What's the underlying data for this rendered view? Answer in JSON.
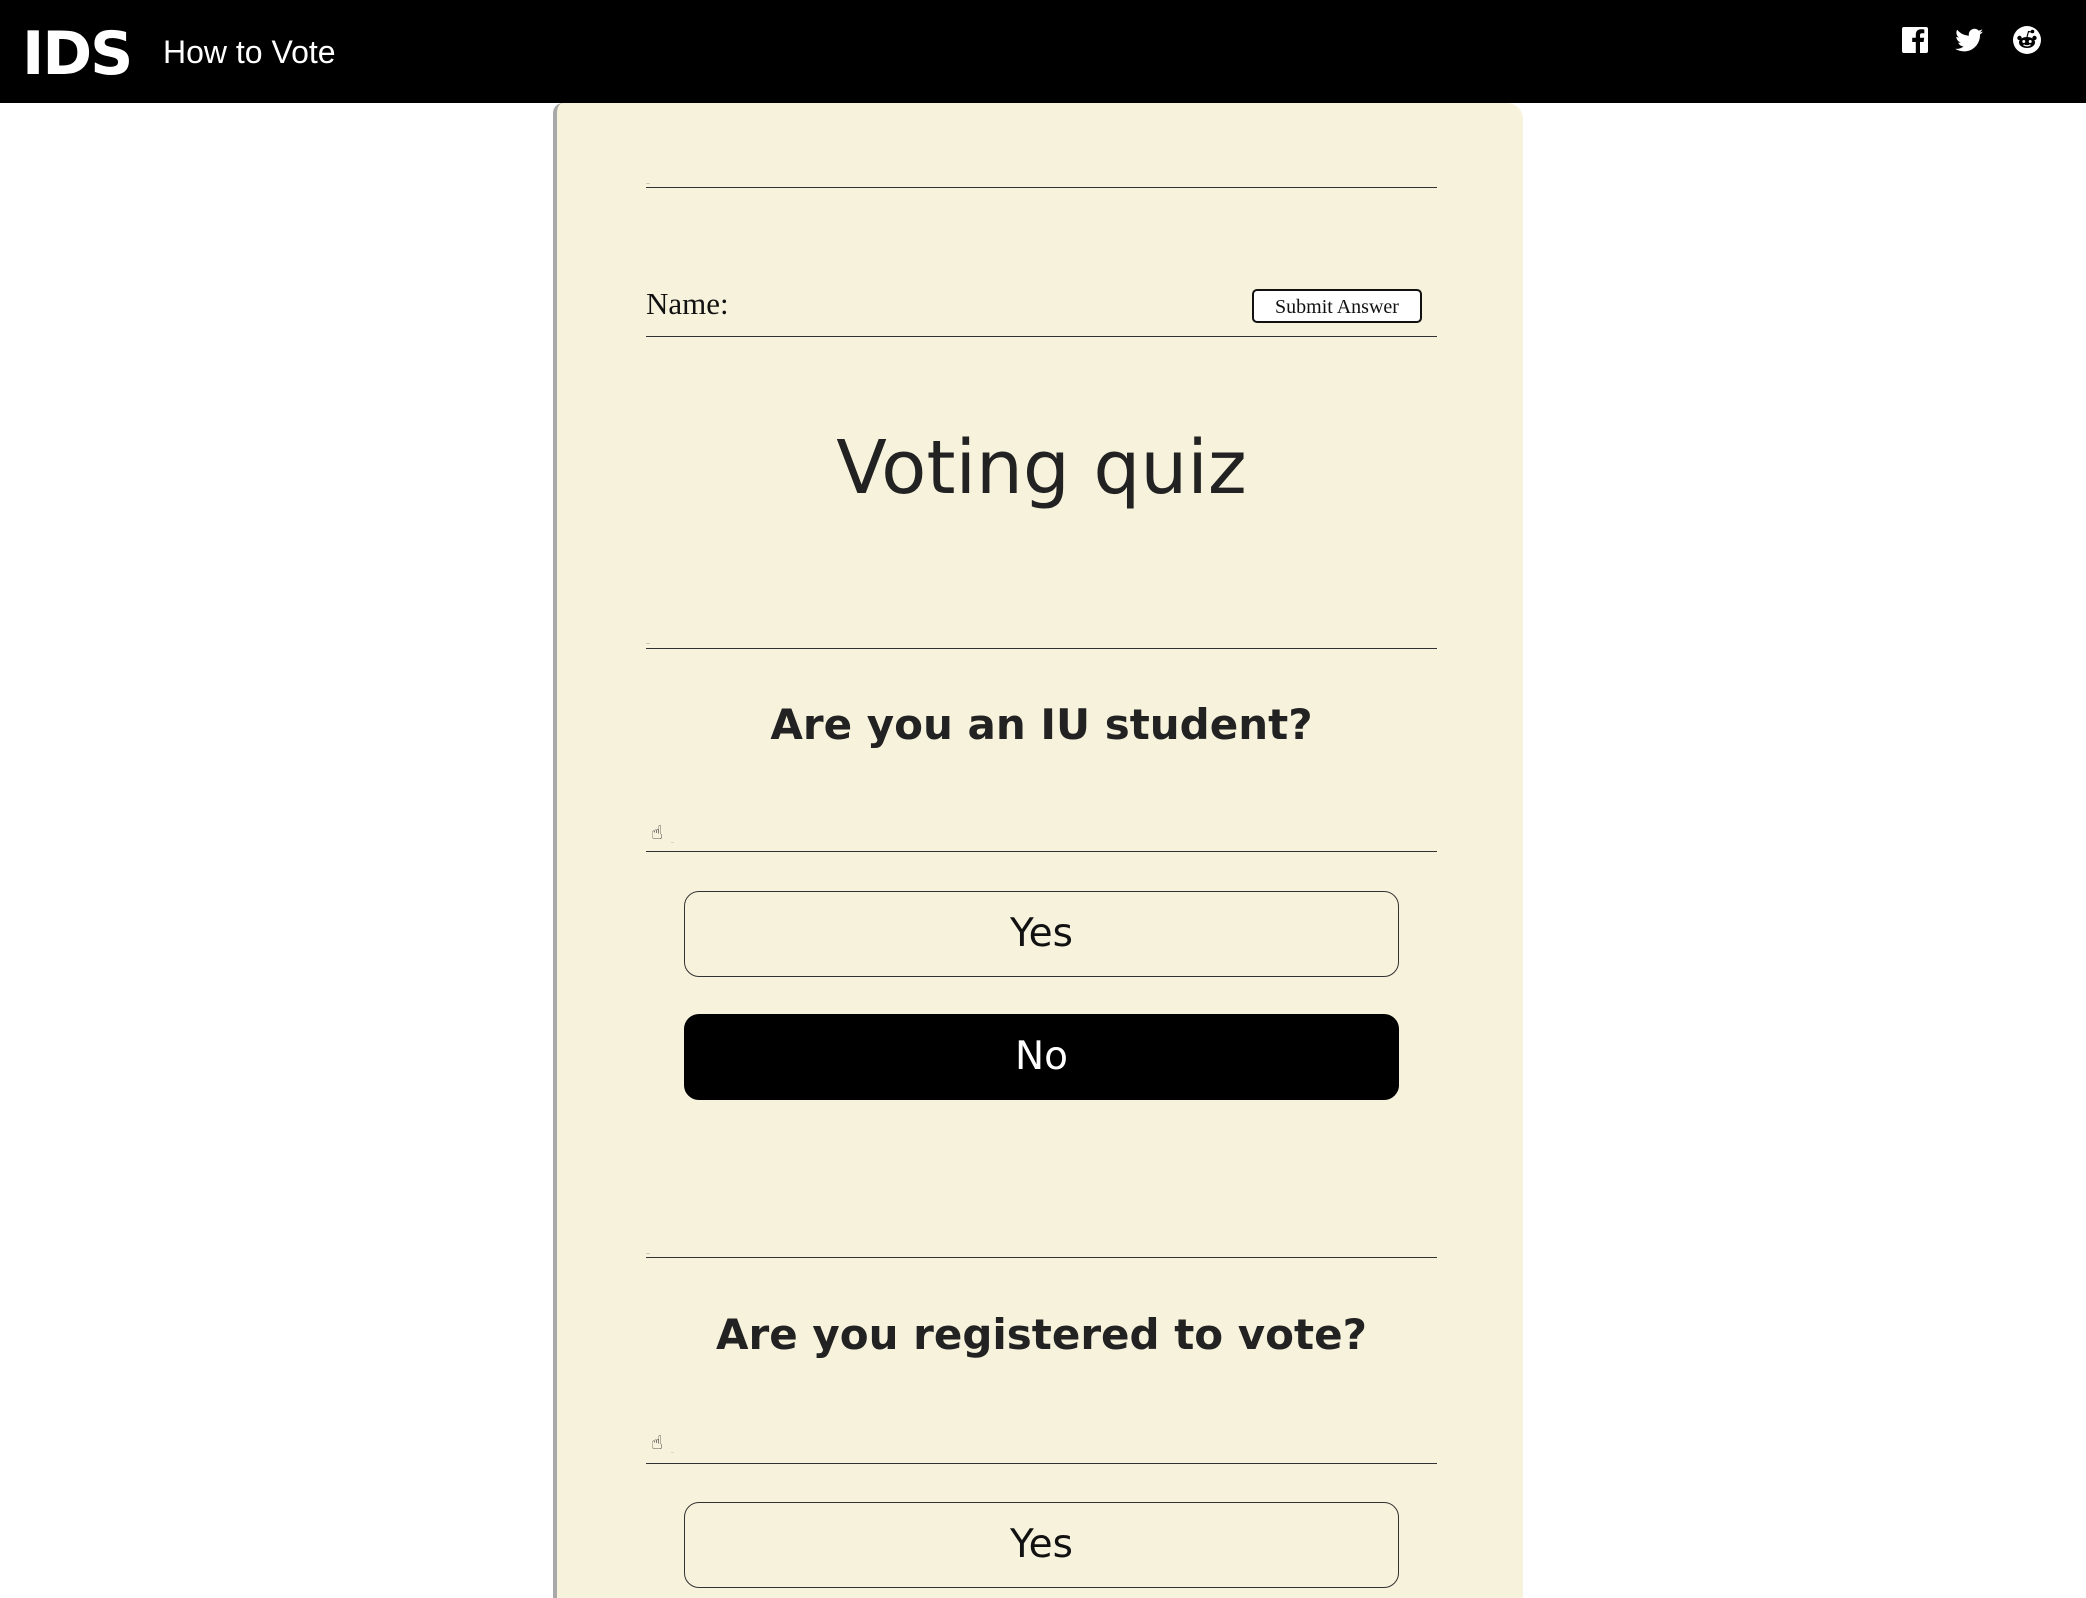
{
  "header": {
    "logo": "IDS",
    "title": "How to Vote",
    "social": [
      {
        "icon": "facebook-icon"
      },
      {
        "icon": "twitter-icon"
      },
      {
        "icon": "reddit-icon"
      }
    ]
  },
  "form": {
    "name_label": "Name:",
    "name_value": "",
    "submit_label": "Submit Answer"
  },
  "quiz": {
    "title": "Voting quiz",
    "questions": [
      {
        "text": "Are you an IU student?",
        "hint_icon": "pointing-hand-icon",
        "answers": [
          {
            "label": "Yes",
            "selected": false
          },
          {
            "label": "No",
            "selected": true
          }
        ]
      },
      {
        "text": "Are you registered to vote?",
        "hint_icon": "pointing-hand-icon",
        "answers": [
          {
            "label": "Yes",
            "selected": false
          }
        ]
      }
    ]
  },
  "colors": {
    "header_bg": "#000000",
    "card_bg": "#f6f2dc",
    "selected_bg": "#000000",
    "text": "#222222"
  }
}
